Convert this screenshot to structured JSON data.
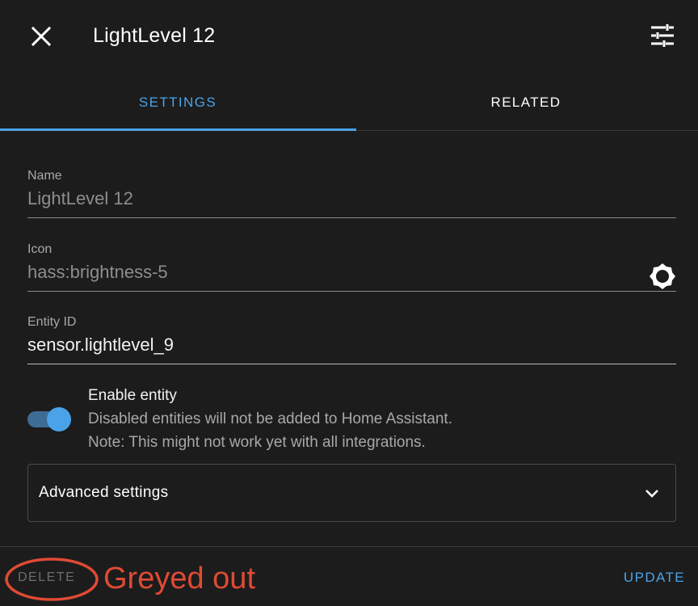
{
  "header": {
    "title": "LightLevel 12",
    "close_icon": "close-icon",
    "settings_icon": "tune-icon"
  },
  "tabs": [
    {
      "label": "SETTINGS",
      "active": true
    },
    {
      "label": "RELATED",
      "active": false
    }
  ],
  "form": {
    "name": {
      "label": "Name",
      "value": "LightLevel 12"
    },
    "icon": {
      "label": "Icon",
      "value": "hass:brightness-5",
      "preview_icon": "brightness-5-icon"
    },
    "entity_id": {
      "label": "Entity ID",
      "value": "sensor.lightlevel_9"
    },
    "enable": {
      "title": "Enable entity",
      "desc_line1": "Disabled entities will not be added to Home Assistant.",
      "desc_line2": "Note: This might not work yet with all integrations.",
      "checked": true
    },
    "advanced": {
      "label": "Advanced settings"
    }
  },
  "footer": {
    "delete_label": "DELETE",
    "update_label": "UPDATE"
  },
  "annotation": {
    "text": "Greyed out"
  },
  "colors": {
    "accent": "#4aa3e8",
    "background": "#1c1c1c",
    "annotation": "#e04a34"
  }
}
